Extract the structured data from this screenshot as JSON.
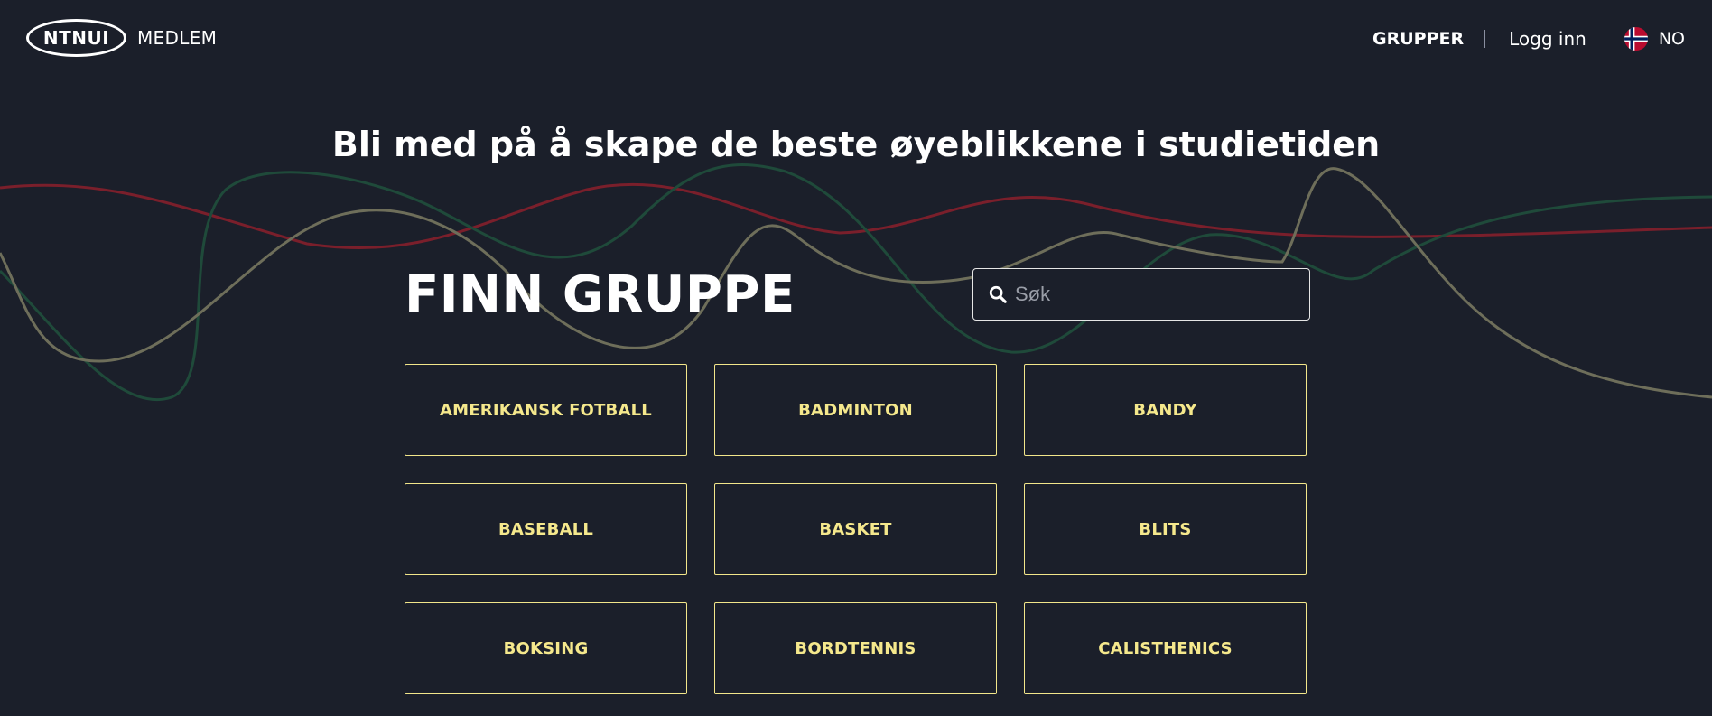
{
  "header": {
    "logo_text": "NTNUI",
    "logo_sub": "MEDLEM",
    "nav": {
      "groups_label": "GRUPPER",
      "login_label": "Logg inn",
      "language_label": "NO",
      "language_icon": "norway-flag-icon"
    }
  },
  "hero": {
    "title": "Bli med på å skape de beste øyeblikkene i studietiden"
  },
  "finder": {
    "title": "FINN GRUPPE",
    "search_placeholder": "Søk",
    "search_icon": "search-icon"
  },
  "groups": [
    {
      "label": "AMERIKANSK FOTBALL"
    },
    {
      "label": "BADMINTON"
    },
    {
      "label": "BANDY"
    },
    {
      "label": "BASEBALL"
    },
    {
      "label": "BASKET"
    },
    {
      "label": "BLITS"
    },
    {
      "label": "BOKSING"
    },
    {
      "label": "BORDTENNIS"
    },
    {
      "label": "CALISTHENICS"
    }
  ],
  "colors": {
    "background": "#1b1f2a",
    "accent": "#f5e88c",
    "text": "#ffffff",
    "wave_red": "#7a1f2b",
    "wave_green": "#1f4a3a",
    "wave_olive": "#6e6e5a"
  }
}
